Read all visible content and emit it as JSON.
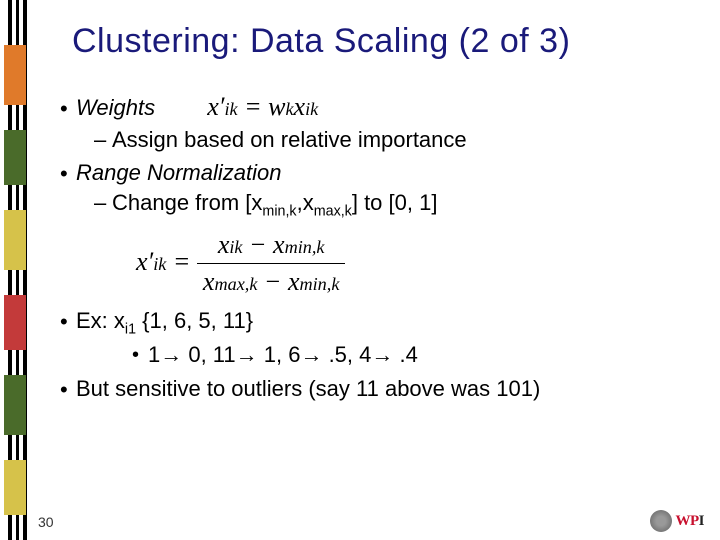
{
  "slide": {
    "title": "Clustering: Data Scaling (2 of 3)",
    "number": "30"
  },
  "bullets": {
    "weights": {
      "label": "Weights",
      "formula": {
        "lhs": "x′",
        "lhs_sub": "ik",
        "eq": " = ",
        "w": "w",
        "w_sub": "k",
        "x": "x",
        "x_sub": "ik"
      },
      "sub1": "Assign based on relative importance"
    },
    "range": {
      "label": "Range Normalization",
      "sub1_pre": "Change from [x",
      "sub1_s1": "min,k",
      "sub1_mid": ",x",
      "sub1_s2": "max,k",
      "sub1_post": "] to [0, 1]",
      "formula": {
        "lhs": "x′",
        "lhs_sub": "ik",
        "eq": " = ",
        "num_a": "x",
        "num_a_sub": "ik",
        "minus": " − ",
        "num_b": "x",
        "num_b_sub": "min,k",
        "den_a": "x",
        "den_a_sub": "max,k",
        "den_b": "x",
        "den_b_sub": "min,k"
      }
    },
    "ex": {
      "pre": "Ex: x",
      "sub": "i1",
      "post": " {1, 6, 5, 11}",
      "mapping": "1→ 0, 11→ 1, 6→ .5, 4→ .4"
    },
    "outlier": "But sensitive to outliers (say 11 above was 101)"
  },
  "logo": {
    "text": "WPI"
  }
}
